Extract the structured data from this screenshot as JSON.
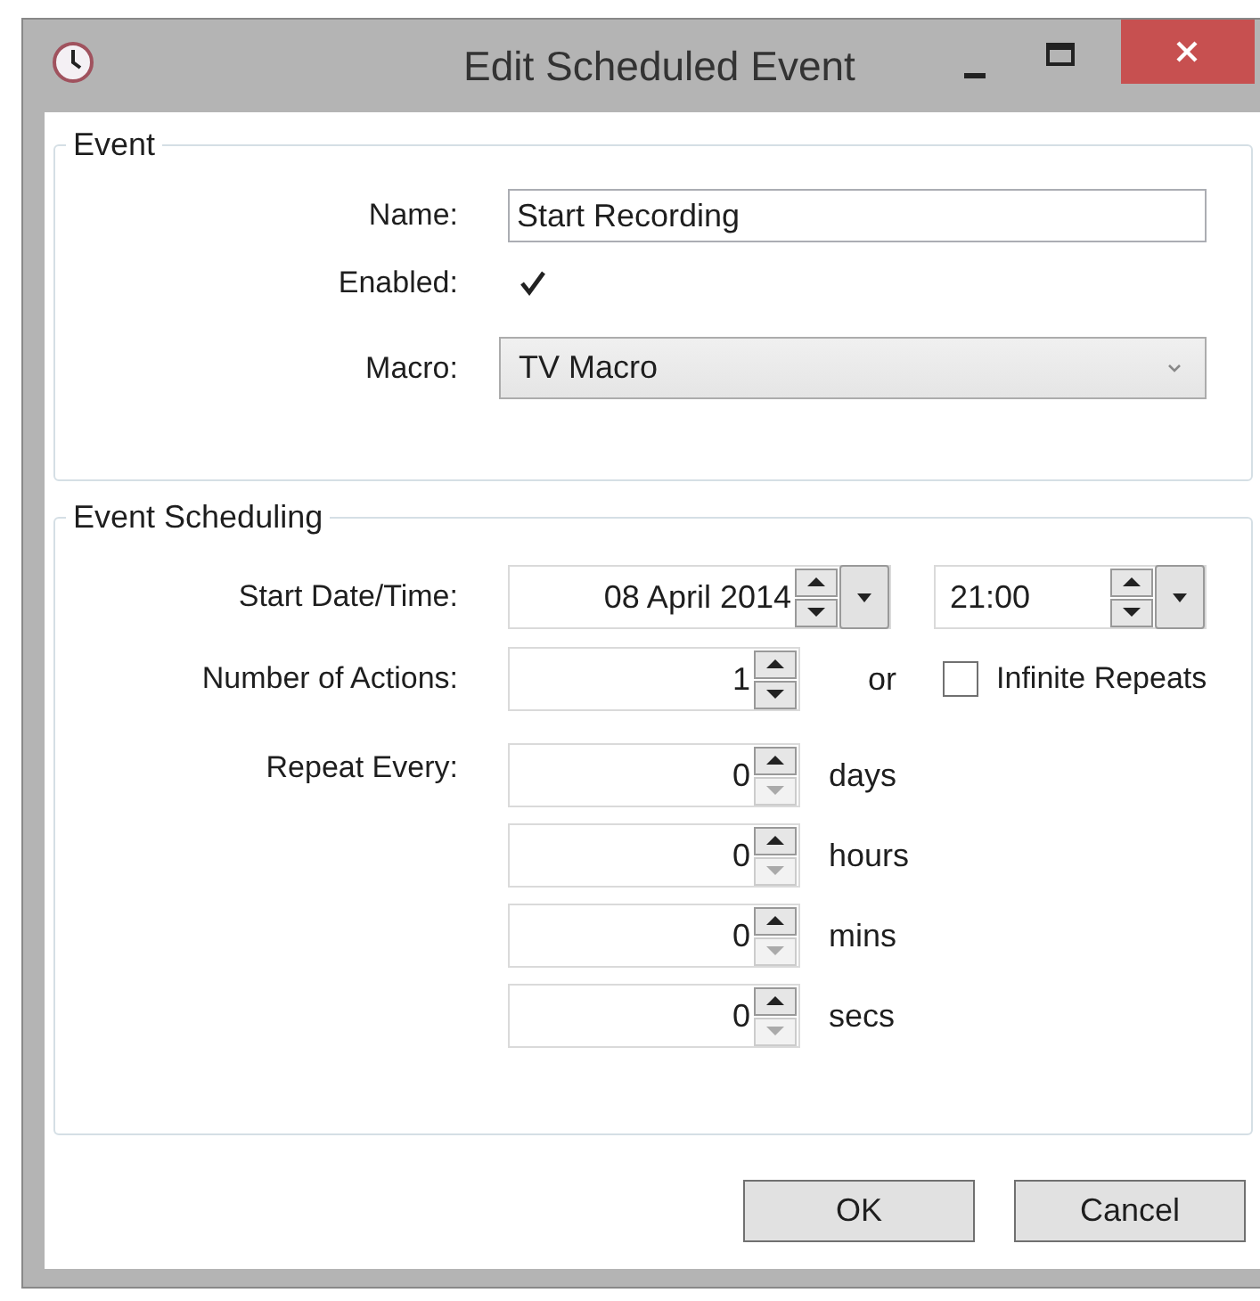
{
  "window": {
    "title": "Edit Scheduled Event"
  },
  "event": {
    "legend": "Event",
    "name_label": "Name:",
    "name_value": "Start Recording",
    "enabled_label": "Enabled:",
    "enabled": true,
    "macro_label": "Macro:",
    "macro_value": "TV Macro"
  },
  "scheduling": {
    "legend": "Event Scheduling",
    "start_label": "Start Date/Time:",
    "date_value": "08 April 2014",
    "time_value": "21:00",
    "actions_label": "Number of Actions:",
    "actions_value": "1",
    "actions_down_disabled": false,
    "or_text": "or",
    "infinite_label": "Infinite Repeats",
    "infinite": false,
    "repeat_label": "Repeat Every:",
    "repeat": [
      {
        "value": "0",
        "unit": "days",
        "down_disabled": true
      },
      {
        "value": "0",
        "unit": "hours",
        "down_disabled": true
      },
      {
        "value": "0",
        "unit": "mins",
        "down_disabled": true
      },
      {
        "value": "0",
        "unit": "secs",
        "down_disabled": true
      }
    ]
  },
  "buttons": [
    "OK",
    "Cancel"
  ]
}
